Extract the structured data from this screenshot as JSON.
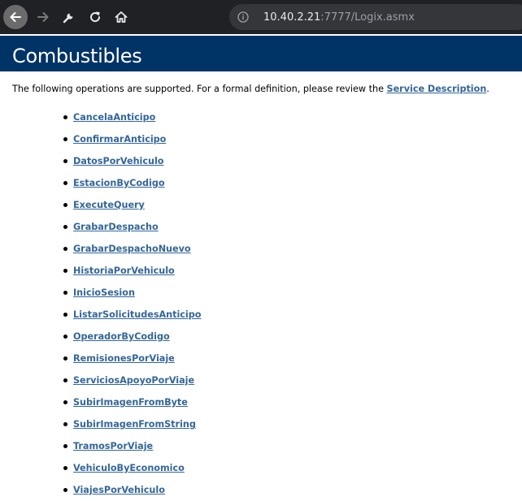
{
  "browser": {
    "url_host": "10.40.2.21",
    "url_rest": ":7777/Logix.asmx",
    "icons": {
      "back": "back-arrow-icon",
      "forward": "forward-arrow-icon",
      "wrench": "wrench-icon",
      "reload": "reload-icon",
      "home": "home-icon",
      "info": "info-icon"
    }
  },
  "page": {
    "title": "Combustibles",
    "intro_text": "The following operations are supported. For a formal definition, please review the ",
    "service_description_link": "Service Description",
    "intro_end": ".",
    "operations": [
      "CancelaAnticipo",
      "ConfirmarAnticipo",
      "DatosPorVehiculo",
      "EstacionByCodigo",
      "ExecuteQuery",
      "GrabarDespacho",
      "GrabarDespachoNuevo",
      "HistoriaPorVehiculo",
      "InicioSesion",
      "ListarSolicitudesAnticipo",
      "OperadorByCodigo",
      "RemisionesPorViaje",
      "ServiciosApoyoPorViaje",
      "SubirImagenFromByte",
      "SubirImagenFromString",
      "TramosPorViaje",
      "VehiculoByEconomico",
      "ViajesPorVehiculo"
    ]
  },
  "colors": {
    "toolbar_bg": "#202124",
    "header_bg": "#003366",
    "link": "#336699"
  }
}
